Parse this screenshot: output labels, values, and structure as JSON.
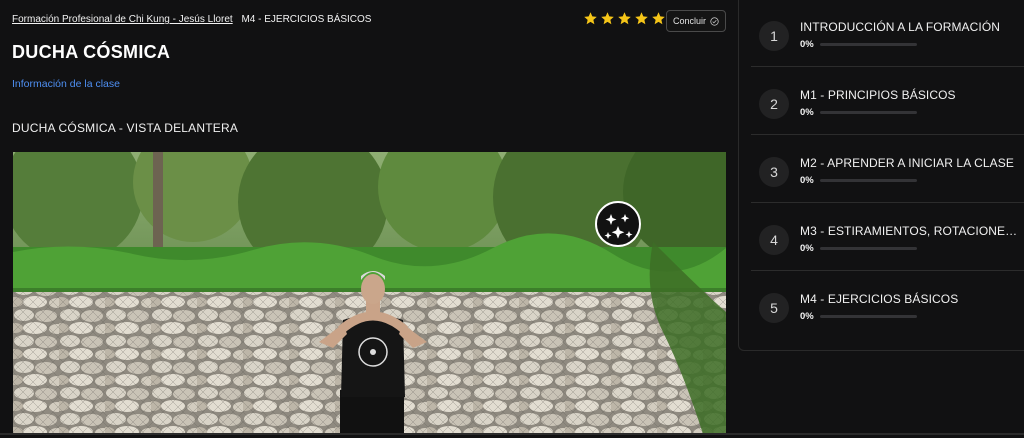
{
  "breadcrumb": {
    "course": "Formación Profesional de Chi Kung - Jesús Lloret",
    "module": "M4 - EJERCICIOS BÁSICOS"
  },
  "rating": {
    "value": 5,
    "max": 5,
    "color": "#f5c518"
  },
  "conclude_button": {
    "label": "Concluir",
    "icon": "check-circle-icon"
  },
  "lesson": {
    "title": "DUCHA CÓSMICA",
    "info_link": "Información de la clase",
    "subtitle": "DUCHA CÓSMICA - VISTA DELANTERA"
  },
  "colors": {
    "accent": "#4e8ff2",
    "background": "#111112"
  },
  "sidebar": {
    "modules": [
      {
        "number": "1",
        "title": "INTRODUCCIÓN A LA FORMACIÓN",
        "progress": "0%",
        "fraction": 0
      },
      {
        "number": "2",
        "title": "M1 - PRINCIPIOS BÁSICOS",
        "progress": "0%",
        "fraction": 0
      },
      {
        "number": "3",
        "title": "M2 - APRENDER A INICIAR LA CLASE",
        "progress": "0%",
        "fraction": 0
      },
      {
        "number": "4",
        "title": "M3 - ESTIRAMIENTOS, ROTACIONES Y...",
        "progress": "0%",
        "fraction": 0
      },
      {
        "number": "5",
        "title": "M4 - EJERCICIOS BÁSICOS",
        "progress": "0%",
        "fraction": 0
      }
    ]
  }
}
